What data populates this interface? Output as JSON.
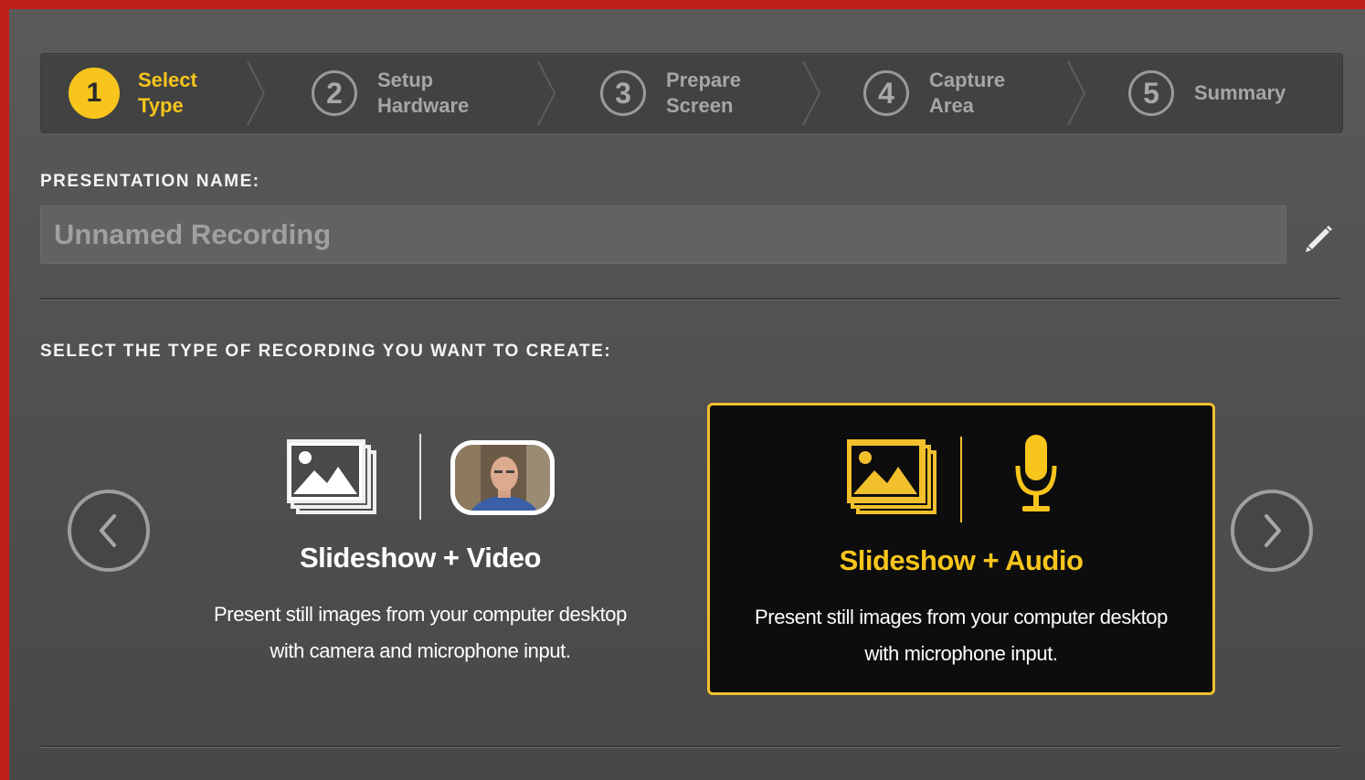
{
  "steps": [
    {
      "number": "1",
      "label_line1": "Select",
      "label_line2": "Type",
      "active": true
    },
    {
      "number": "2",
      "label_line1": "Setup",
      "label_line2": "Hardware",
      "active": false
    },
    {
      "number": "3",
      "label_line1": "Prepare",
      "label_line2": "Screen",
      "active": false
    },
    {
      "number": "4",
      "label_line1": "Capture",
      "label_line2": "Area",
      "active": false
    },
    {
      "number": "5",
      "label_line1": "Summary",
      "label_line2": "",
      "active": false
    }
  ],
  "presentation": {
    "label": "PRESENTATION NAME:",
    "placeholder": "Unnamed Recording",
    "value": "",
    "edit_icon": "pencil-icon"
  },
  "recording_type": {
    "label": "SELECT THE TYPE OF RECORDING YOU WANT TO CREATE:",
    "prev_icon": "chevron-left-icon",
    "next_icon": "chevron-right-icon",
    "options": [
      {
        "title": "Slideshow + Video",
        "description_line1": "Present still images from your computer desktop",
        "description_line2": "with camera and microphone input.",
        "icons": [
          "slideshow-icon",
          "webcam-video-icon"
        ],
        "selected": false
      },
      {
        "title": "Slideshow + Audio",
        "description_line1": "Present still images from your computer desktop",
        "description_line2": "with microphone input.",
        "icons": [
          "slideshow-icon",
          "microphone-icon"
        ],
        "selected": true
      }
    ]
  },
  "colors": {
    "accent": "#f7c51c",
    "frame": "#c0201a",
    "background": "#555555",
    "selected_card": "#0d0d0d"
  }
}
